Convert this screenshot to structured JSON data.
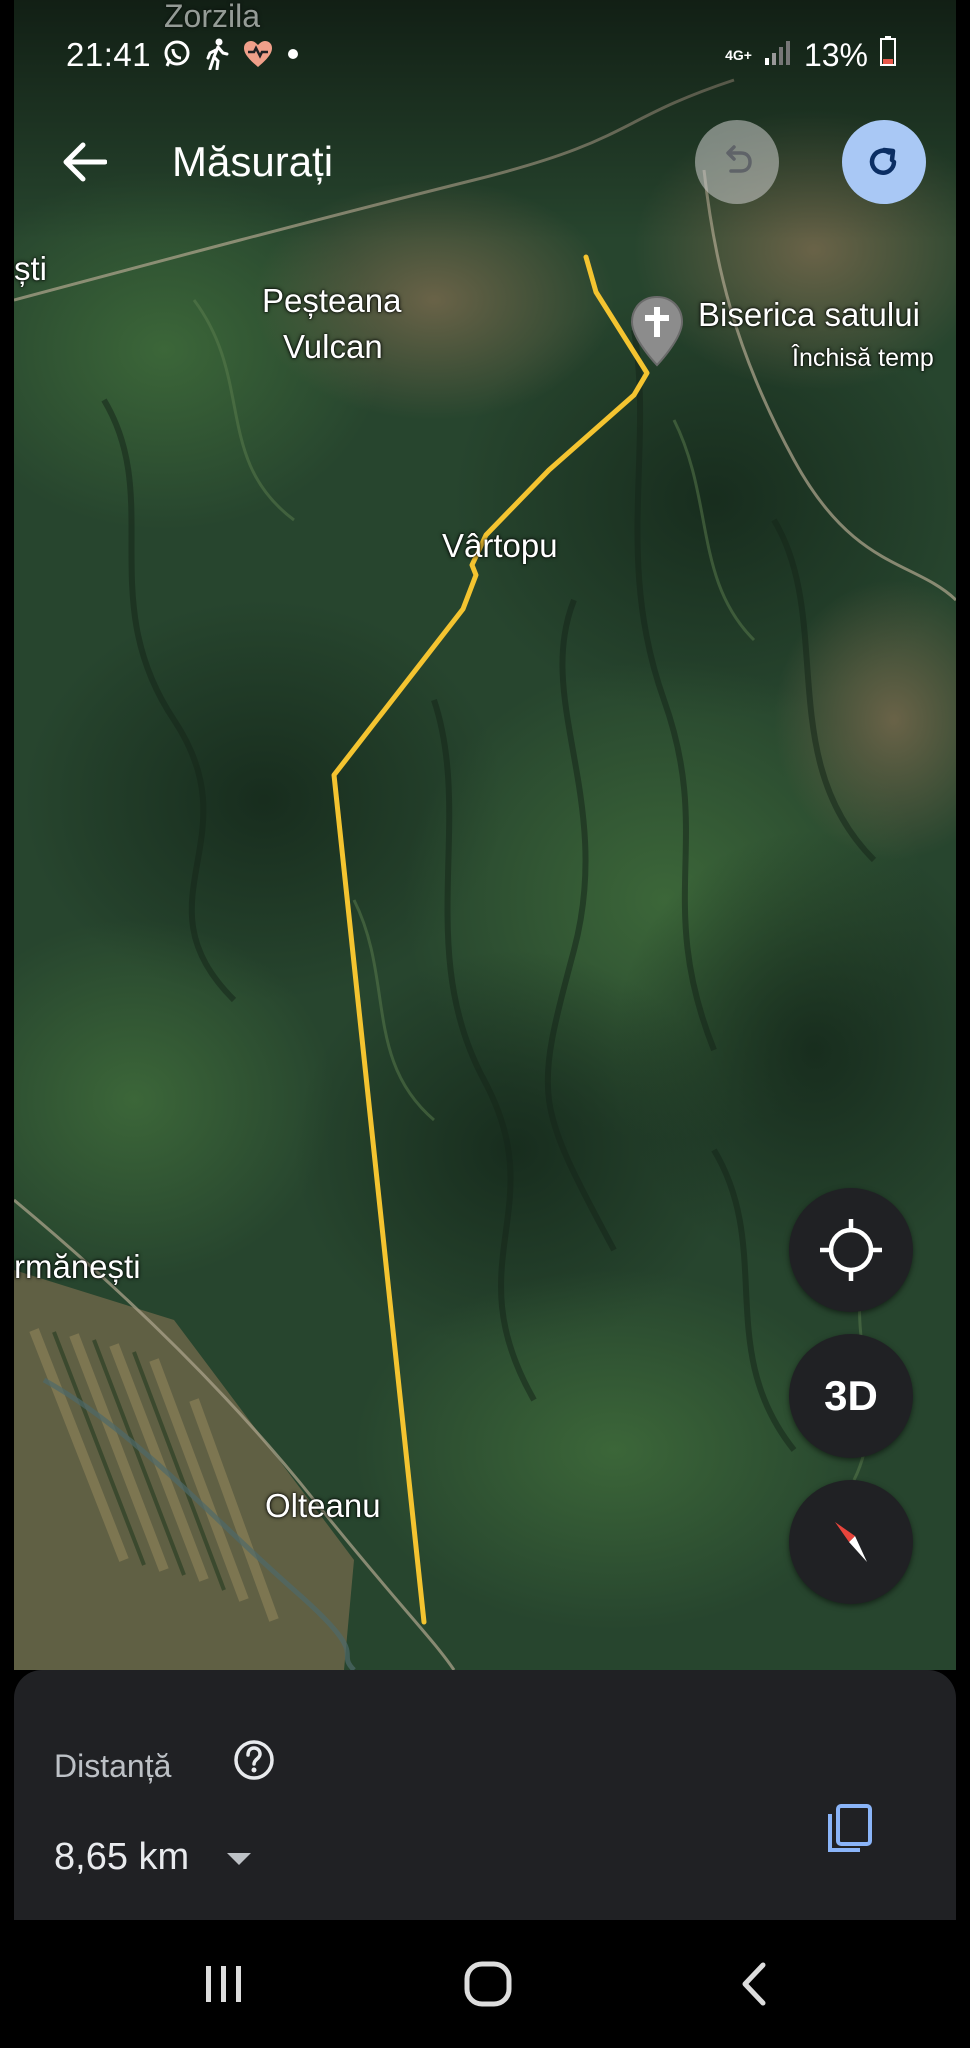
{
  "status_bar": {
    "time": "21:41",
    "network": "4G+",
    "battery": "13%",
    "icons": [
      "whatsapp-icon",
      "walking-icon",
      "health-icon",
      "dot-icon",
      "signal-icon",
      "battery-icon"
    ]
  },
  "app_bar": {
    "title": "Măsurați",
    "icons": [
      "back-arrow-icon",
      "undo-icon",
      "redo-icon"
    ]
  },
  "map": {
    "labels": {
      "top_partial": "Zorzila",
      "left_partial": "ști",
      "village_1_line1": "Peșteana",
      "village_1_line2": "Vulcan",
      "poi_name": "Biserica satului",
      "poi_status": "Închisă temp",
      "vartopu": "Vârtopu",
      "left_village": "rmănești",
      "olteanu": "Olteanu"
    },
    "route_color": "#f4c430"
  },
  "fab": {
    "three_d": "3D",
    "icons": [
      "my-location-icon",
      "compass-icon"
    ]
  },
  "panel": {
    "distance_label": "Distanță",
    "distance_value": "8,65 km",
    "icons": [
      "help-icon",
      "dropdown-icon",
      "copy-icon"
    ]
  },
  "nav_bar": {
    "icons": [
      "recent-apps-icon",
      "home-icon",
      "back-icon"
    ]
  }
}
